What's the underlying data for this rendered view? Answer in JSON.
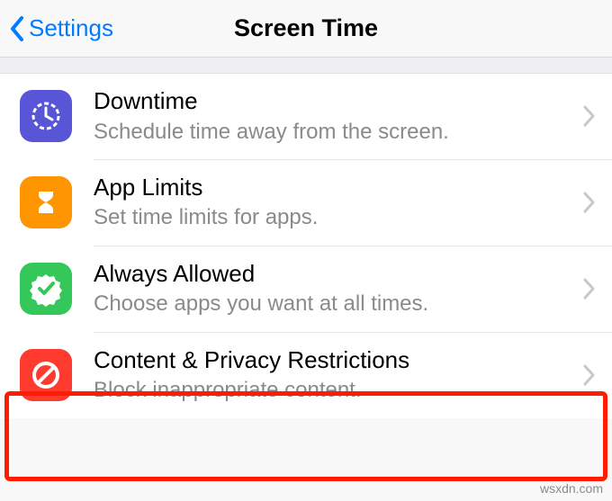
{
  "nav": {
    "back_label": "Settings",
    "title": "Screen Time"
  },
  "rows": {
    "downtime": {
      "title": "Downtime",
      "subtitle": "Schedule time away from the screen."
    },
    "app_limits": {
      "title": "App Limits",
      "subtitle": "Set time limits for apps."
    },
    "always_allowed": {
      "title": "Always Allowed",
      "subtitle": "Choose apps you want at all times."
    },
    "content_privacy": {
      "title": "Content & Privacy Restrictions",
      "subtitle": "Block inappropriate content."
    }
  },
  "watermark": "wsxdn.com",
  "colors": {
    "ios_blue": "#007aff",
    "downtime_bg": "#5856d6",
    "app_limits_bg": "#ff9500",
    "always_allowed_bg": "#34c759",
    "content_privacy_bg": "#ff3b30",
    "highlight_red": "#ff1c00"
  }
}
